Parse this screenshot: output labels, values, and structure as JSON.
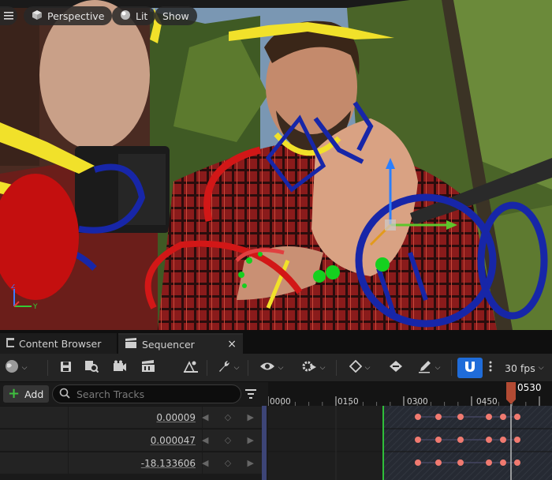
{
  "viewport": {
    "perspective_label": "Perspective",
    "lit_label": "Lit",
    "show_label": "Show",
    "axis_labels": {
      "y": "Y",
      "z": "Z"
    }
  },
  "tabs": [
    {
      "label": "Content Browser",
      "icon": "content-browser-icon"
    },
    {
      "label": "Sequencer",
      "icon": "sequencer-clapper-icon",
      "close": "×"
    }
  ],
  "toolbar": {
    "icons": [
      "world-sphere-icon",
      "save-icon",
      "find-in-browser-icon",
      "render-movie-icon",
      "clapper-icon",
      "cinematics-icon",
      "wrench-icon",
      "eye-icon",
      "gear-play-icon",
      "keyframe-diamond-icon",
      "keyframe-add-icon",
      "pen-icon",
      "snap-magnet-icon",
      "more-vert-icon"
    ],
    "fps": "30 fps",
    "accent": "#1f6cd9"
  },
  "tracks": {
    "add_label": "Add",
    "search_placeholder": "Search Tracks",
    "rows": [
      {
        "value": "0.00009"
      },
      {
        "value": "0.000047"
      },
      {
        "value": "-18.133606"
      }
    ]
  },
  "timeline": {
    "ticks": [
      "0000",
      "0150",
      "0300",
      "0450"
    ],
    "playhead": "0530",
    "key_color": "#f07a70",
    "playhead_color": "#c0563b",
    "start_marker_color": "#2fbf3a"
  }
}
